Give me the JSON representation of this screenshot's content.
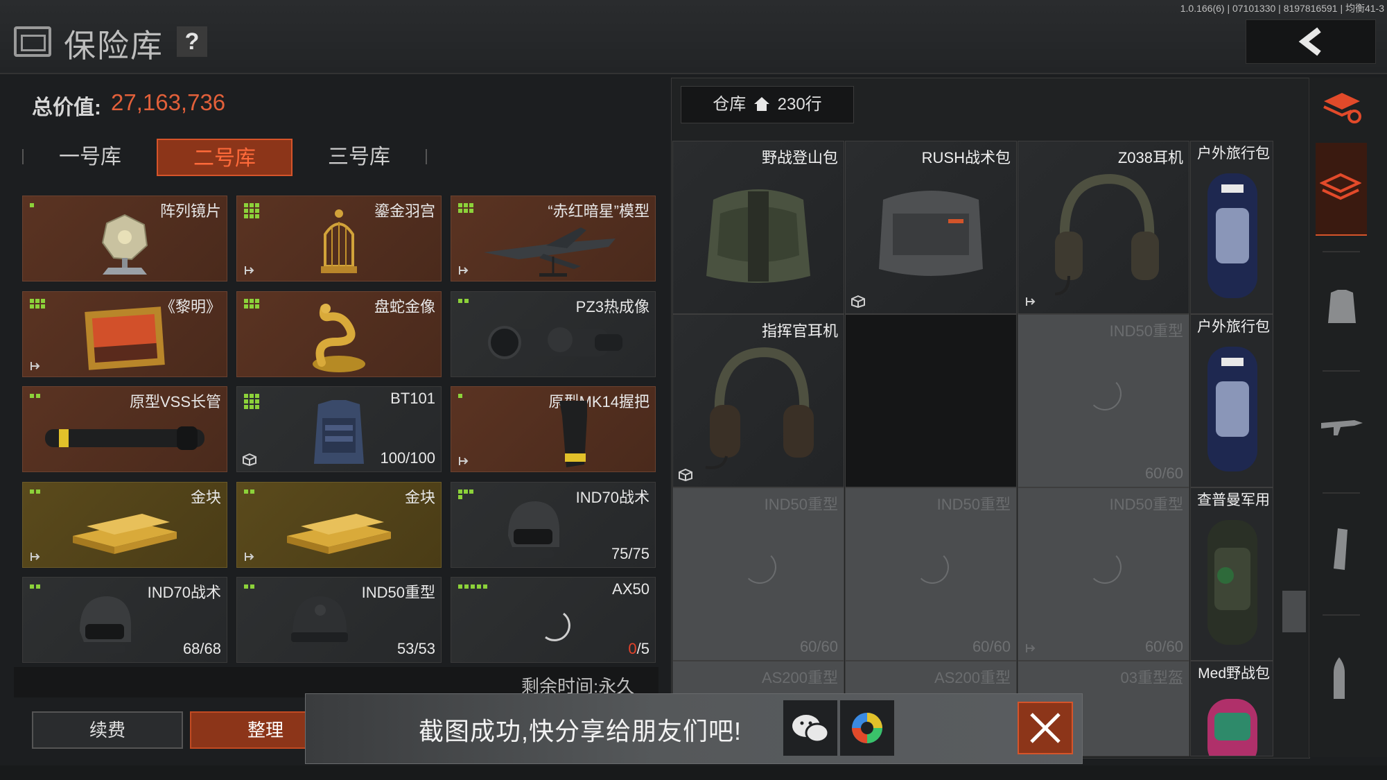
{
  "version_text": "1.0.166(6) | 07101330 | 8197816591 | 均衡41-3",
  "header": {
    "title": "保险库",
    "help_label": "?"
  },
  "total": {
    "label": "总价值:",
    "value": "27,163,736",
    "value_color": "#e2603a"
  },
  "tabs": [
    {
      "label": "一号库",
      "active": false
    },
    {
      "label": "二号库",
      "active": true
    },
    {
      "label": "三号库",
      "active": false
    }
  ],
  "vault_items": [
    {
      "name": "阵列镜片",
      "count": "",
      "bg": "brown",
      "icon": "lens-array-icon"
    },
    {
      "name": "鎏金羽宫",
      "count": "",
      "bg": "brown",
      "icon": "golden-birdcage-icon"
    },
    {
      "name": "“赤红暗星”模型",
      "count": "",
      "bg": "brown",
      "icon": "jet-model-icon"
    },
    {
      "name": "《黎明》",
      "count": "",
      "bg": "brown",
      "icon": "painting-icon"
    },
    {
      "name": "盘蛇金像",
      "count": "",
      "bg": "brown",
      "icon": "golden-snake-icon"
    },
    {
      "name": "PZ3热成像",
      "count": "",
      "bg": "gray",
      "icon": "thermal-scope-icon"
    },
    {
      "name": "原型VSS长管",
      "count": "",
      "bg": "brown",
      "icon": "barrel-icon"
    },
    {
      "name": "BT101",
      "count": "100/100",
      "bg": "gray",
      "icon": "armor-vest-icon"
    },
    {
      "name": "原型MK14握把",
      "count": "",
      "bg": "brown",
      "icon": "grip-icon"
    },
    {
      "name": "金块",
      "count": "",
      "bg": "gold",
      "icon": "gold-bar-icon"
    },
    {
      "name": "金块",
      "count": "",
      "bg": "gold",
      "icon": "gold-bar-icon"
    },
    {
      "name": "IND70战术",
      "count": "75/75",
      "bg": "gray",
      "icon": "helmet-icon"
    },
    {
      "name": "IND70战术",
      "count": "68/68",
      "bg": "gray",
      "icon": "helmet-icon"
    },
    {
      "name": "IND50重型",
      "count": "53/53",
      "bg": "gray",
      "icon": "helmet-icon"
    },
    {
      "name": "AX50",
      "count_left": "0",
      "count_right": "/5",
      "bg": "gray",
      "icon": "loading-icon"
    }
  ],
  "remain": "剩余时间:永久",
  "buttons": {
    "renew": "续费",
    "sort": "整理"
  },
  "warehouse": {
    "tab_label": "仓库",
    "rows_label": "230行",
    "cells": [
      {
        "name": "野战登山包",
        "count": "",
        "style": "dark",
        "icon": "backpack-icon"
      },
      {
        "name": "RUSH战术包",
        "count": "",
        "style": "dark",
        "icon": "backpack-icon"
      },
      {
        "name": "Z038耳机",
        "count": "",
        "style": "dark",
        "icon": "headset-icon"
      },
      {
        "name": "指挥官耳机",
        "count": "",
        "style": "dark",
        "icon": "headset-icon"
      },
      {
        "name": "",
        "count": "",
        "style": "black",
        "icon": ""
      },
      {
        "name": "IND50重型",
        "count": "60/60",
        "style": "light",
        "icon": "loading-icon"
      },
      {
        "name": "IND50重型",
        "count": "60/60",
        "style": "light",
        "icon": "loading-icon"
      },
      {
        "name": "IND50重型",
        "count": "60/60",
        "style": "light",
        "icon": "loading-icon"
      },
      {
        "name": "IND50重型",
        "count": "60/60",
        "style": "light",
        "icon": "loading-icon"
      },
      {
        "name": "AS200重型",
        "count": "",
        "style": "light",
        "icon": "loading-icon"
      },
      {
        "name": "AS200重型",
        "count": "",
        "style": "light",
        "icon": "loading-icon"
      },
      {
        "name": "03重型盔",
        "count": "",
        "style": "light",
        "icon": "loading-icon"
      }
    ],
    "narrow_cells": [
      {
        "name": "户外旅行包"
      },
      {
        "name": "户外旅行包"
      },
      {
        "name": "查普曼军用"
      },
      {
        "name": "Med野战包"
      }
    ]
  },
  "toast": {
    "text": "截图成功,快分享给朋友们吧!"
  },
  "sidebar": [
    "stack-refresh-icon",
    "stack-icon",
    "armor-icon",
    "rifle-icon",
    "magazine-icon",
    "bullet-icon"
  ]
}
